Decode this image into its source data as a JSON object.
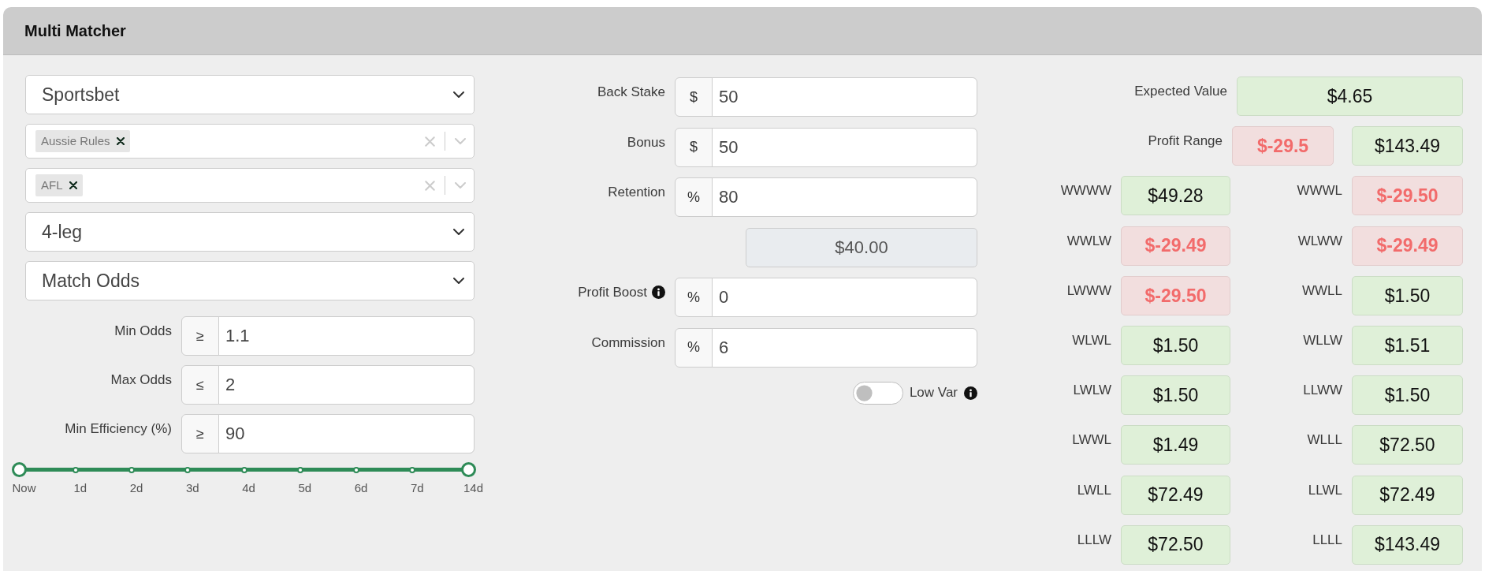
{
  "panel": {
    "title": "Multi Matcher"
  },
  "filters": {
    "selects": [
      {
        "kind": "single",
        "value": "Sportsbet"
      },
      {
        "kind": "multi",
        "tags": [
          "Aussie Rules"
        ]
      },
      {
        "kind": "multi",
        "tags": [
          "AFL"
        ]
      },
      {
        "kind": "single",
        "value": "4-leg"
      },
      {
        "kind": "single",
        "value": "Match Odds"
      }
    ],
    "limits": [
      {
        "label": "Min Odds",
        "prefix": "≥",
        "value": "1.1"
      },
      {
        "label": "Max Odds",
        "prefix": "≤",
        "value": "2"
      },
      {
        "label": "Min Efficiency (%)",
        "prefix": "≥",
        "value": "90"
      }
    ],
    "time_range": {
      "level": 1,
      "ticks": [
        "Now",
        "1d",
        "2d",
        "3d",
        "4d",
        "5d",
        "6d",
        "7d",
        "14d"
      ]
    }
  },
  "stake": {
    "fields": [
      {
        "kind": "input",
        "label": "Back Stake",
        "prefix": "$",
        "value": "50",
        "info": false
      },
      {
        "kind": "input",
        "label": "Bonus",
        "prefix": "$",
        "value": "50",
        "info": false
      },
      {
        "kind": "input",
        "label": "Retention",
        "prefix": "%",
        "value": "80",
        "info": false
      },
      {
        "kind": "output",
        "value": "$40.00",
        "info": false
      },
      {
        "kind": "input",
        "label": "Profit Boost",
        "prefix": "%",
        "value": "0",
        "info": true
      },
      {
        "kind": "input",
        "label": "Commission",
        "prefix": "%",
        "value": "6",
        "info": false
      }
    ],
    "low_var": {
      "label": "Low Var",
      "on": false
    }
  },
  "results": {
    "expected_value": {
      "label": "Expected Value",
      "value": "$4.65",
      "loss": false
    },
    "profit_range": {
      "label": "Profit Range",
      "values": [
        {
          "value": "$-29.5",
          "loss": true
        },
        {
          "value": "$143.49",
          "loss": false
        }
      ]
    },
    "outcomes": [
      {
        "label": "WWWW",
        "value": "$49.28",
        "loss": false
      },
      {
        "label": "WWWL",
        "value": "$-29.50",
        "loss": true
      },
      {
        "label": "WWLW",
        "value": "$-29.49",
        "loss": true
      },
      {
        "label": "WLWW",
        "value": "$-29.49",
        "loss": true
      },
      {
        "label": "LWWW",
        "value": "$-29.50",
        "loss": true
      },
      {
        "label": "WWLL",
        "value": "$1.50",
        "loss": false
      },
      {
        "label": "WLWL",
        "value": "$1.50",
        "loss": false
      },
      {
        "label": "WLLW",
        "value": "$1.51",
        "loss": false
      },
      {
        "label": "LWLW",
        "value": "$1.50",
        "loss": false
      },
      {
        "label": "LLWW",
        "value": "$1.50",
        "loss": false
      },
      {
        "label": "LWWL",
        "value": "$1.49",
        "loss": false
      },
      {
        "label": "WLLL",
        "value": "$72.50",
        "loss": false
      },
      {
        "label": "LWLL",
        "value": "$72.49",
        "loss": false
      },
      {
        "label": "LLWL",
        "value": "$72.49",
        "loss": false
      },
      {
        "label": "LLLW",
        "value": "$72.50",
        "loss": false
      },
      {
        "label": "LLLL",
        "value": "$143.49",
        "loss": false
      }
    ]
  }
}
